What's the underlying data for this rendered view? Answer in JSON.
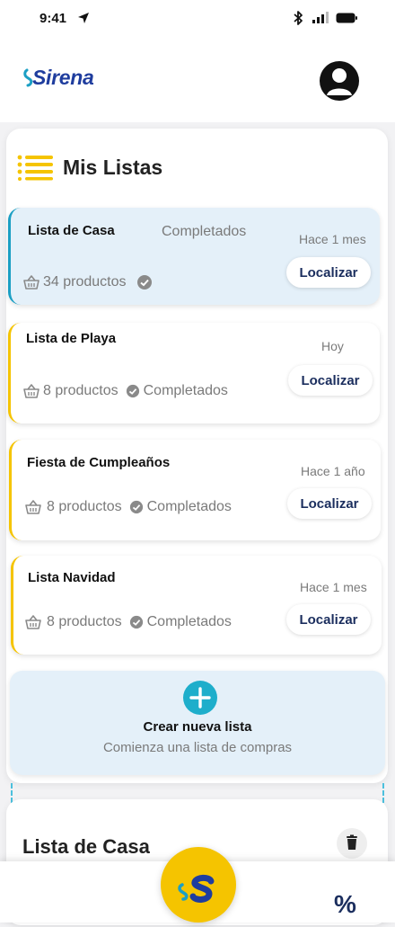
{
  "status_bar": {
    "time": "9:41"
  },
  "app": {
    "brand": "Sirena",
    "brand_color": "#1f3d9e",
    "accent_yellow": "#f5c400",
    "accent_teal": "#1b9fc4"
  },
  "header": {
    "icon": "list-icon",
    "title": "Mis Listas"
  },
  "lists": [
    {
      "name": "Lista de Casa",
      "status_top": "Completados",
      "time": "Hace 1 mes",
      "products": "34 productos",
      "status": "",
      "button": "Localizar",
      "selected": true
    },
    {
      "name": "Lista de Playa",
      "time": "Hoy",
      "products": "8 productos",
      "status": "Completados",
      "button": "Localizar"
    },
    {
      "name": "Fiesta de Cumpleaños",
      "time": "Hace 1 año",
      "products": "8 productos",
      "status": "Completados",
      "button": "Localizar"
    },
    {
      "name": "Lista Navidad",
      "time": "Hace 1 mes",
      "products": "8 productos",
      "status": "Completados",
      "button": "Localizar"
    }
  ],
  "create": {
    "title": "Crear nueva lista",
    "subtitle": "Comienza una lista de compras"
  },
  "detail": {
    "title": "Lista de Casa"
  },
  "bottom_nav": {
    "center_icon": "sirena-logo-icon",
    "right_label": "%"
  }
}
